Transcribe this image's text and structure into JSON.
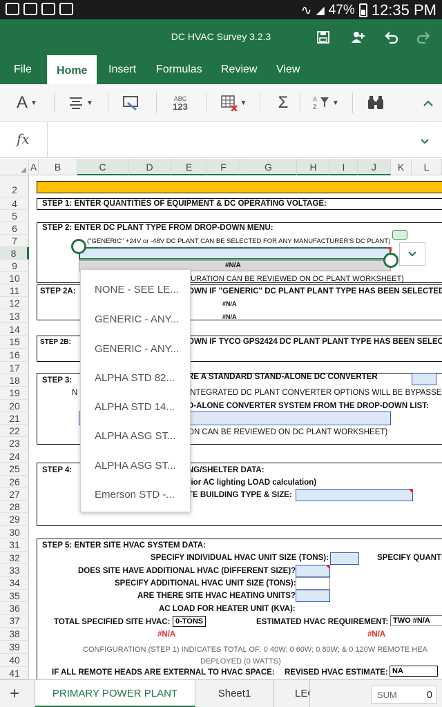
{
  "status_bar": {
    "battery": "47%",
    "time": "12:35 PM"
  },
  "app": {
    "title": "DC HVAC Survey 3.2.3"
  },
  "ribbon": {
    "tabs": [
      "File",
      "Home",
      "Insert",
      "Formulas",
      "Review",
      "View"
    ],
    "active_tab": "Home"
  },
  "toolbar": {
    "number_format_label": "ABC\n123",
    "sum_symbol": "Σ"
  },
  "formula_bar": {
    "fx_label": "fx",
    "value": ""
  },
  "columns": [
    "A",
    "B",
    "C",
    "D",
    "E",
    "F",
    "G",
    "H",
    "I",
    "J",
    "K",
    "L"
  ],
  "rows": [
    "2",
    "4",
    "5",
    "6",
    "7",
    "8",
    "9",
    "10",
    "11",
    "12",
    "13",
    "14",
    "15",
    "16",
    "17",
    "18",
    "19",
    "20",
    "21",
    "22",
    "23",
    "24",
    "25",
    "26",
    "27",
    "28",
    "29",
    "30",
    "31",
    "32",
    "33",
    "34",
    "35",
    "36",
    "37",
    "38",
    "39",
    "40",
    "41"
  ],
  "sheet": {
    "step1": "STEP 1:   ENTER QUANTITIES OF EQUIPMENT & DC OPERATING VOLTAGE:",
    "step2": "STEP 2:   ENTER DC PLANT TYPE FROM DROP-DOWN MENU:",
    "row7": "(\"GENERIC\" +24V or -48V DC PLANT CAN BE SELECTED FOR ANY MANUFACTURER'S DC PLANT)",
    "na": "#N/A",
    "row10": "URATION CAN BE REVIEWED ON DC PLANT WORKSHEET)",
    "step2a_label": "STEP 2A:",
    "row11": "OWN  IF \"GENERIC\" DC PLANT PLANT TYPE HAS BEEN SELECTED:",
    "step2b_label": "STEP 2B:",
    "row15": "OWN IF TYCO GPS2424 DC PLANT PLANT TYPE HAS BEEN SELECTED:",
    "step3_label": "STEP 3:",
    "row18": "RE A STANDARD STAND-ALONE DC CONVERTER",
    "row19a": "N",
    "row19b": "INTEGRATED DC PLANT CONVERTER OPTIONS WILL BE BYPASSED",
    "row20": "D-ALONE CONVERTER SYSTEM FROM THE DROP-DOWN LIST:",
    "row22": "ON CAN BE REVIEWED ON DC PLANT WORKSHEET)",
    "step4_label": "STEP 4:",
    "row25": "NG/SHELTER DATA:",
    "row26": "rior AC lighting LOAD calculation)",
    "row27": "TE BUILDING TYPE & SIZE:",
    "step5": "STEP 5:   ENTER SITE HVAC SYSTEM DATA:",
    "r32": "SPECIFY INDIVIDUAL HVAC UNIT SIZE (TONS):",
    "r32b": "SPECIFY QUANTI",
    "r33": "DOES SITE HAVE ADDITIONAL HVAC (DIFFERENT SIZE)?",
    "r34": "SPECIFY ADDITIONAL HVAC UNIT SIZE (TONS):",
    "r35": "ARE THERE SITE HVAC HEATING UNITS?",
    "r36": "AC LOAD FOR HEATER UNIT (KVA):",
    "r37a": "TOTAL SPECIFIED SITE HVAC:",
    "r37b": "0-TONS",
    "r37c": "ESTIMATED HVAC REQUIREMENT:",
    "r37d": "TWO",
    "r37e": "#N/A",
    "r39": "CONFIGURATION (STEP 1) INDICATES TOTAL OF: 0 40W; 0 60W; 0 80W; & 0 120W REMOTE HEA",
    "r40": "DEPLOYED (0 WATTS)",
    "r41a": "IF ALL REMOTE HEADS ARE EXTERNAL TO HVAC SPACE:",
    "r41b": "REVISED HVAC ESTIMATE:",
    "r41c": "NA"
  },
  "dropdown": {
    "items": [
      "NONE - SEE LE...",
      "GENERIC - ANY...",
      "GENERIC - ANY...",
      "ALPHA STD 82...",
      "ALPHA STD 14...",
      "ALPHA ASG ST...",
      "ALPHA ASG ST...",
      "Emerson STD -..."
    ]
  },
  "sheet_tabs": [
    "PRIMARY POWER PLANT",
    "Sheet1",
    "LEC"
  ],
  "status": {
    "sum_label": "SUM",
    "sum_value": "0"
  },
  "colors": {
    "accent": "#217346",
    "header_fill": "#ffc000",
    "input_fill": "#dbe9f6",
    "error": "#e03030"
  }
}
